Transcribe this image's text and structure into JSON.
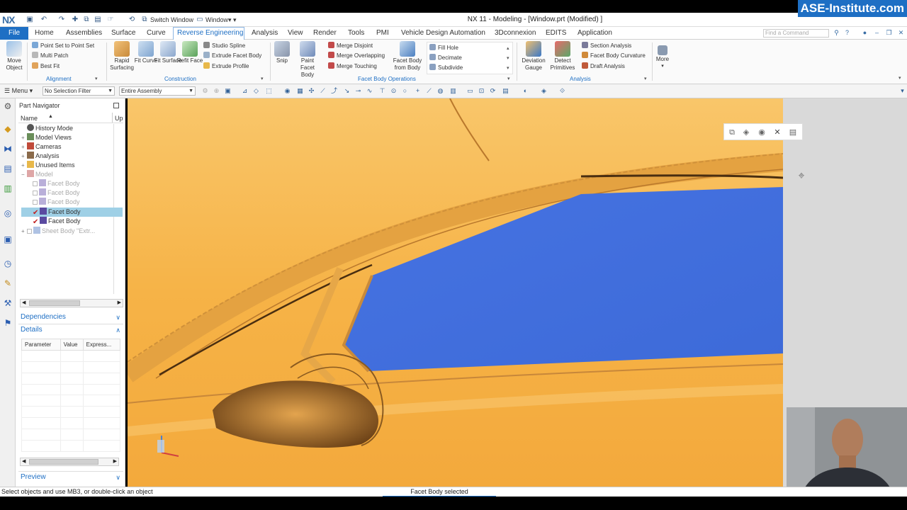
{
  "window": {
    "logo": "NX",
    "title": "NX 11 - Modeling - [Window.prt (Modified) ]",
    "brand": "ASE-Institute.com",
    "switch_window": "Switch Window",
    "window_menu": "Window"
  },
  "menu": {
    "file": "File",
    "tabs": [
      "Home",
      "Assemblies",
      "Surface",
      "Curve",
      "Reverse Engineering",
      "Analysis",
      "View",
      "Render",
      "Tools",
      "PMI",
      "Vehicle Design Automation",
      "3Dconnexion",
      "EDITS",
      "Application"
    ],
    "active_tab": "Reverse Engineering",
    "find_placeholder": "Find a Command"
  },
  "ribbon": {
    "move_object": "Move Object",
    "alignment": {
      "label": "Alignment",
      "items": [
        "Point Set to Point Set",
        "Multi Patch",
        "Best Fit"
      ]
    },
    "construction": {
      "label": "Construction",
      "big": [
        "Rapid Surfacing",
        "Fit Curve",
        "Fit Surface",
        "Refit Face"
      ],
      "small": [
        "Studio Spline",
        "Extrude Facet Body",
        "Extrude Profile"
      ]
    },
    "facet_ops": {
      "label": "Facet Body Operations",
      "big": [
        "Snip",
        "Paint Facet Body"
      ],
      "small": [
        "Merge Disjoint",
        "Merge Overlapping",
        "Merge Touching"
      ],
      "from_body": "Facet Body from Body",
      "gallery": [
        "Fill Hole",
        "Decimate",
        "Subdivide"
      ]
    },
    "analysis": {
      "label": "Analysis",
      "big": [
        "Deviation Gauge",
        "Detect Primitives"
      ],
      "small": [
        "Section Analysis",
        "Facet Body Curvature",
        "Draft Analysis"
      ]
    },
    "more": "More"
  },
  "toolbar": {
    "menu": "Menu",
    "selection_filter": "No Selection Filter",
    "assembly_scope": "Entire Assembly"
  },
  "navigator": {
    "title": "Part Navigator",
    "col_name": "Name",
    "col_up": "Up",
    "rows": [
      {
        "label": "History Mode",
        "icon": "clock-icon"
      },
      {
        "label": "Model Views",
        "icon": "views-icon"
      },
      {
        "label": "Cameras",
        "icon": "camera-icon"
      },
      {
        "label": "Analysis",
        "icon": "analysis-icon"
      },
      {
        "label": "Unused Items",
        "icon": "folder-icon"
      },
      {
        "label": "Model",
        "icon": "model-icon"
      },
      {
        "label": "Facet Body",
        "icon": "facet-body-icon"
      },
      {
        "label": "Facet Body",
        "icon": "facet-body-icon"
      },
      {
        "label": "Facet Body",
        "icon": "facet-body-icon"
      },
      {
        "label": "Facet Body",
        "icon": "facet-body-icon"
      },
      {
        "label": "Facet Body",
        "icon": "facet-body-icon"
      },
      {
        "label": "Sheet Body \"Extr...",
        "icon": "sheet-body-icon"
      }
    ],
    "dependencies": "Dependencies",
    "details": "Details",
    "detail_cols": [
      "Parameter",
      "Value",
      "Express..."
    ],
    "preview": "Preview"
  },
  "status": {
    "left": "Select objects and use MB3, or double-click an object",
    "middle": "Facet Body selected"
  },
  "colors": {
    "accent": "#1e6fc4",
    "part_body": "#f7b84a",
    "glass": "#3f6fe0",
    "selection": "#9fd0e6"
  }
}
